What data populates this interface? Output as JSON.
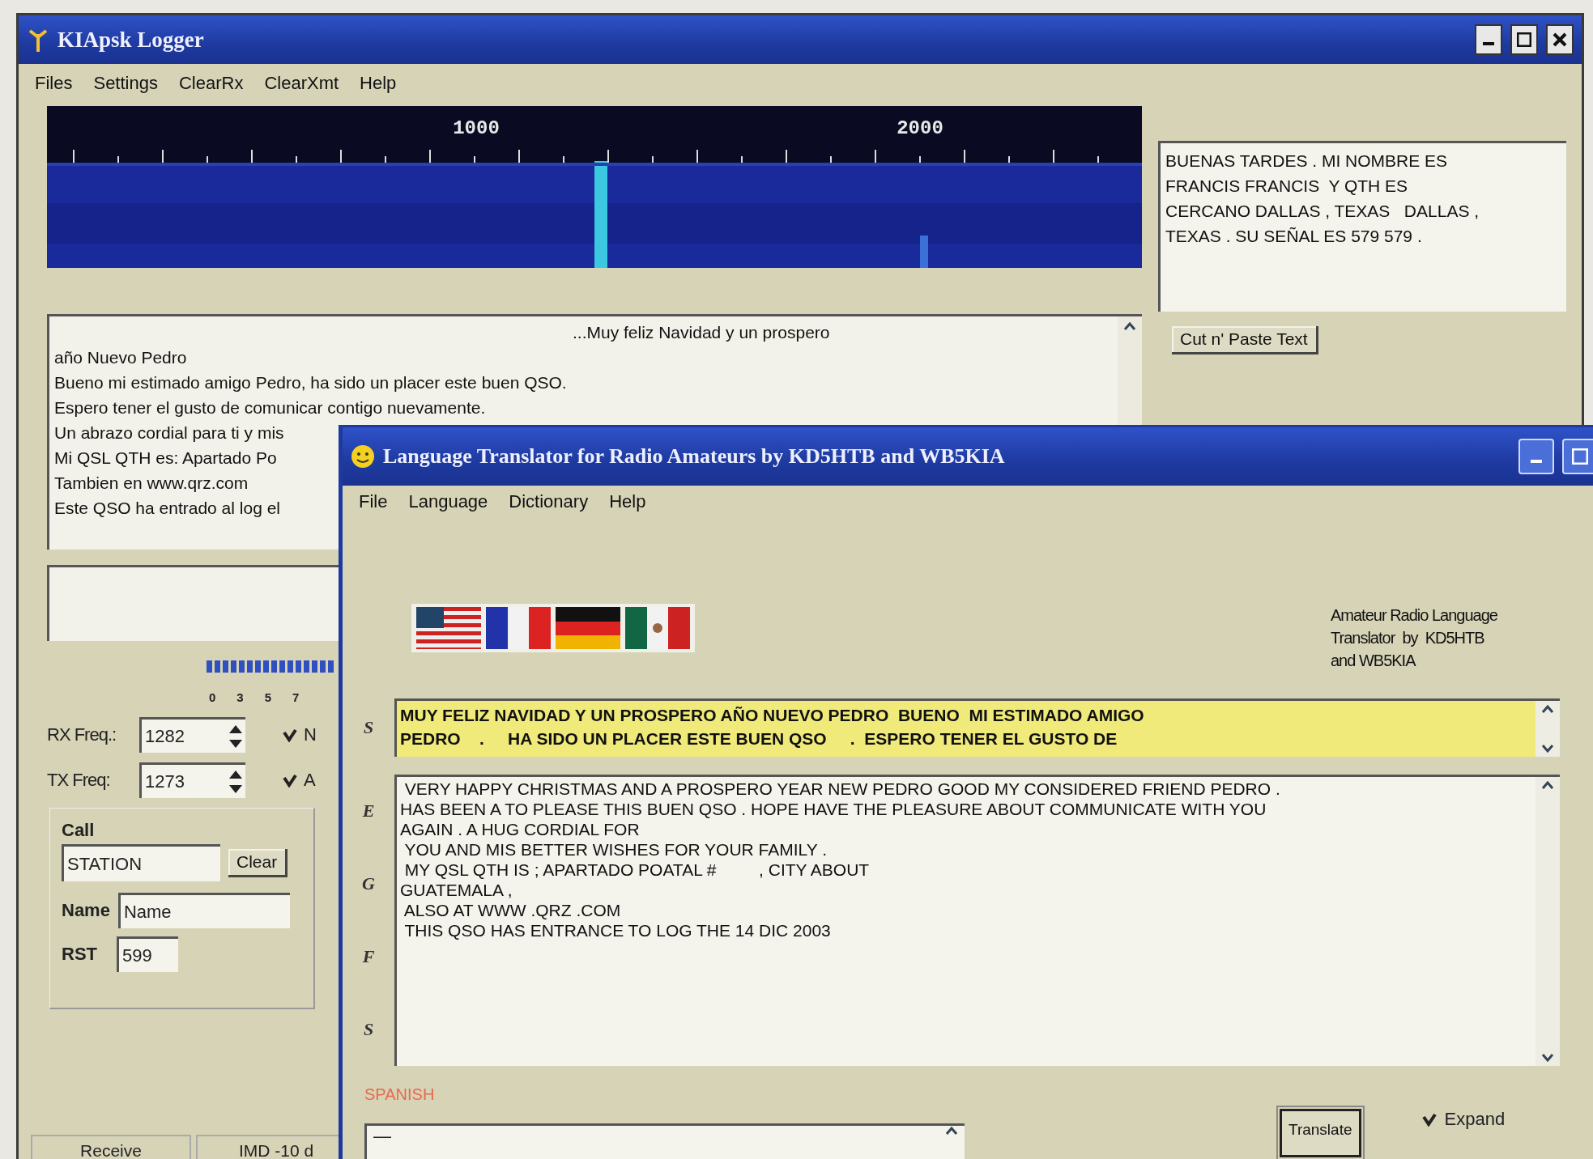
{
  "logger": {
    "title": "KIApsk Logger",
    "menu": [
      "Files",
      "Settings",
      "ClearRx",
      "ClearXmt",
      "Help"
    ],
    "waterfall": {
      "scale_labels": [
        "1000",
        "2000"
      ]
    },
    "rx_text": {
      "first_line": "...Muy feliz Navidad y un prospero",
      "lines": [
        "año Nuevo Pedro",
        "Bueno mi estimado amigo Pedro, ha sido un placer este buen QSO.",
        "Espero tener el gusto de comunicar contigo nuevamente.",
        "Un abrazo cordial para ti y mis",
        "Mi QSL QTH es: Apartado Po",
        "Tambien en www.qrz.com",
        "Este QSO ha entrado al log el"
      ]
    },
    "side_text": [
      "BUENAS TARDES . MI NOMBRE ES",
      "FRANCIS FRANCIS  Y QTH ES",
      "CERCANO DALLAS , TEXAS   DALLAS ,",
      "TEXAS . SU SEÑAL ES 579 579 ."
    ],
    "cut_paste_button": "Cut n' Paste Text",
    "meter_scale": [
      "0",
      "3",
      "5",
      "7"
    ],
    "rx_freq": {
      "label": "RX Freq.:",
      "value": "1282"
    },
    "tx_freq": {
      "label": "TX Freq:",
      "value": "1273"
    },
    "checkboxes": [
      {
        "label": "N",
        "checked": true
      },
      {
        "label": "A",
        "checked": true
      }
    ],
    "station": {
      "call_label": "Call",
      "call": "STATION",
      "clear_button": "Clear",
      "name_label": "Name",
      "name": "Name",
      "rst_label": "RST",
      "rst": "599"
    },
    "status_bar": [
      "Receive",
      "IMD -10 d"
    ]
  },
  "translator": {
    "title": "Language Translator for Radio Amateurs by KD5HTB and WB5KIA",
    "menu": [
      "File",
      "Language",
      "Dictionary",
      "Help"
    ],
    "credit": [
      "Amateur Radio Language",
      "Translator  by  KD5HTB",
      "and WB5KIA"
    ],
    "source_side_label": "S",
    "source_lines": [
      "MUY FELIZ NAVIDAD Y UN PROSPERO AÑO NUEVO PEDRO  BUENO  MI ESTIMADO AMIGO",
      "PEDRO    .     HA SIDO UN PLACER ESTE BUEN QSO     .  ESPERO TENER EL GUSTO DE"
    ],
    "target_side_labels": [
      "E",
      "G",
      "F",
      "S"
    ],
    "target_lines": [
      " VERY HAPPY CHRISTMAS AND A PROSPERO YEAR NEW PEDRO GOOD MY CONSIDERED FRIEND PEDRO .",
      "HAS BEEN A TO PLEASE THIS BUEN QSO . HOPE HAVE THE PLEASURE ABOUT COMMUNICATE WITH YOU",
      "AGAIN . A HUG CORDIAL FOR",
      " YOU AND MIS BETTER WISHES FOR YOUR FAMILY .",
      " MY QSL QTH IS ; APARTADO POATAL #         , CITY ABOUT",
      "GUATEMALA ,",
      " ALSO AT WWW .QRZ .COM",
      " THIS QSO HAS ENTRANCE TO LOG THE 14 DIC 2003"
    ],
    "language_label": "SPANISH",
    "input_value": "—",
    "translate_button": "Translate",
    "expand": {
      "label": "Expand",
      "checked": true
    }
  }
}
